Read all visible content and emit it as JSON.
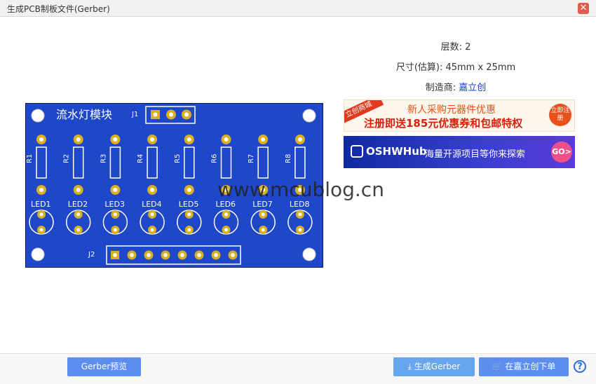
{
  "window": {
    "title": "生成PCB制板文件(Gerber)"
  },
  "info": {
    "layers": "层数: 2",
    "size": "尺寸(估算): 45mm x 25mm",
    "maker_label": "制造商: ",
    "maker_link": "嘉立创"
  },
  "pcb": {
    "title": "流水灯模块",
    "j1": "J1",
    "j2": "J2",
    "resistors": [
      "R1",
      "R2",
      "R3",
      "R4",
      "R5",
      "R6",
      "R7",
      "R8"
    ],
    "leds": [
      "LED1",
      "LED2",
      "LED3",
      "LED4",
      "LED5",
      "LED6",
      "LED7",
      "LED8"
    ]
  },
  "banner1": {
    "corner": "立创商城",
    "line1": "新人采购元器件优惠",
    "line2": "注册即送185元优惠券和包邮特权",
    "cta": "立即注册"
  },
  "banner2": {
    "brand": "OSHWHub",
    "text": "海量开源项目等你来探索",
    "cta": "GO>"
  },
  "watermark": "www.mcublog.cn",
  "buttons": {
    "preview": "Gerber预览",
    "generate": "生成Gerber",
    "order": "在嘉立创下单"
  },
  "colors": {
    "board": "#1f47c9",
    "pad": "#d8b020",
    "accent": "#5b8ef0"
  }
}
